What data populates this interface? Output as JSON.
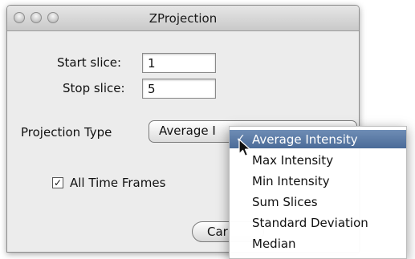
{
  "window": {
    "title": "ZProjection"
  },
  "form": {
    "start_slice_label": "Start slice:",
    "start_slice_value": "1",
    "stop_slice_label": "Stop slice:",
    "stop_slice_value": "5",
    "projection_type_label": "Projection Type",
    "projection_type_value": "Average I",
    "all_time_frames_label": "All Time Frames",
    "all_time_frames_checked": true,
    "cancel_label": "Car"
  },
  "dropdown_menu": {
    "selected_index": 0,
    "items": [
      {
        "label": "Average Intensity"
      },
      {
        "label": "Max Intensity"
      },
      {
        "label": "Min Intensity"
      },
      {
        "label": "Sum Slices"
      },
      {
        "label": "Standard Deviation"
      },
      {
        "label": "Median"
      }
    ]
  },
  "icons": {
    "check": "checkmark-icon",
    "pointer": "mouse-pointer-icon"
  }
}
